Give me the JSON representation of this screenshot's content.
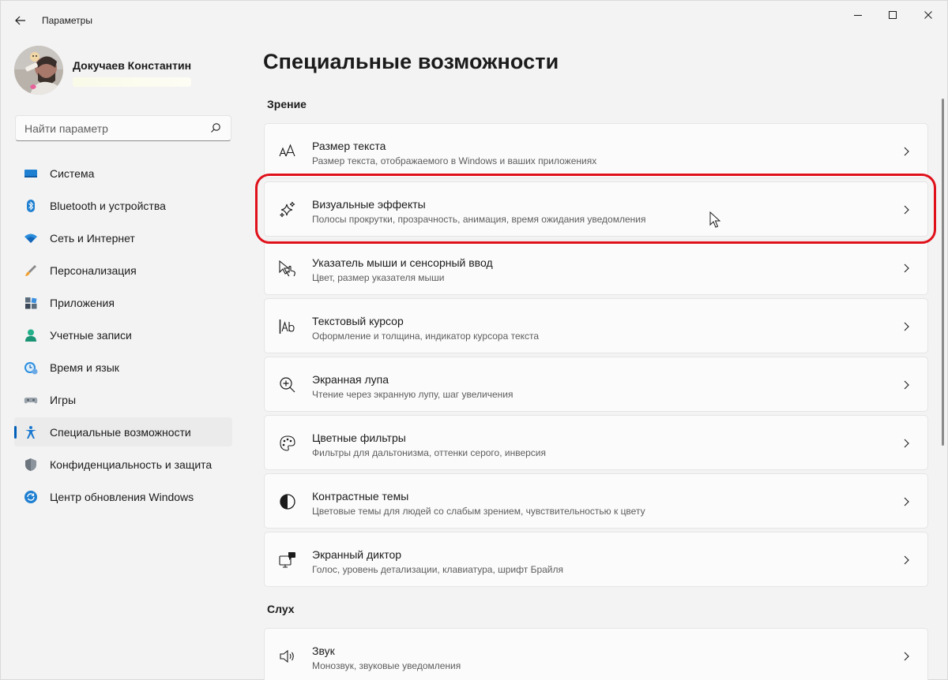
{
  "app": {
    "title": "Параметры"
  },
  "profile": {
    "name": "Докучаев Константин"
  },
  "search": {
    "placeholder": "Найти параметр"
  },
  "sidebar": {
    "items": [
      {
        "label": "Система",
        "icon": "monitor-icon"
      },
      {
        "label": "Bluetooth и устройства",
        "icon": "bluetooth-icon"
      },
      {
        "label": "Сеть и Интернет",
        "icon": "wifi-icon"
      },
      {
        "label": "Персонализация",
        "icon": "brush-icon"
      },
      {
        "label": "Приложения",
        "icon": "apps-icon"
      },
      {
        "label": "Учетные записи",
        "icon": "person-icon"
      },
      {
        "label": "Время и язык",
        "icon": "clock-globe-icon"
      },
      {
        "label": "Игры",
        "icon": "gamepad-icon"
      },
      {
        "label": "Специальные возможности",
        "icon": "accessibility-icon",
        "active": true
      },
      {
        "label": "Конфиденциальность и защита",
        "icon": "shield-icon"
      },
      {
        "label": "Центр обновления Windows",
        "icon": "update-icon"
      }
    ]
  },
  "main": {
    "title": "Специальные возможности",
    "sections": [
      {
        "heading": "Зрение"
      },
      {
        "heading": "Слух"
      }
    ],
    "cards": [
      {
        "title": "Размер текста",
        "subtitle": "Размер текста, отображаемого в Windows и ваших приложениях",
        "icon": "text-size-icon"
      },
      {
        "title": "Визуальные эффекты",
        "subtitle": "Полосы прокрутки, прозрачность, анимация, время ожидания уведомления",
        "icon": "sparkle-icon"
      },
      {
        "title": "Указатель мыши и сенсорный ввод",
        "subtitle": "Цвет, размер указателя мыши",
        "icon": "pointer-touch-icon"
      },
      {
        "title": "Текстовый курсор",
        "subtitle": "Оформление и толщина, индикатор курсора текста",
        "icon": "text-cursor-icon"
      },
      {
        "title": "Экранная лупа",
        "subtitle": "Чтение через экранную лупу, шаг увеличения",
        "icon": "magnifier-icon"
      },
      {
        "title": "Цветные фильтры",
        "subtitle": "Фильтры для дальтонизма, оттенки серого, инверсия",
        "icon": "palette-icon"
      },
      {
        "title": "Контрастные темы",
        "subtitle": "Цветовые темы для людей со слабым зрением, чувствительностью к цвету",
        "icon": "contrast-icon"
      },
      {
        "title": "Экранный диктор",
        "subtitle": "Голос, уровень детализации, клавиатура, шрифт Брайля",
        "icon": "narrator-icon"
      },
      {
        "title": "Звук",
        "subtitle": "Монозвук, звуковые уведомления",
        "icon": "speaker-icon"
      }
    ]
  },
  "colors": {
    "accent": "#005fb8",
    "highlight": "#e0101a"
  }
}
